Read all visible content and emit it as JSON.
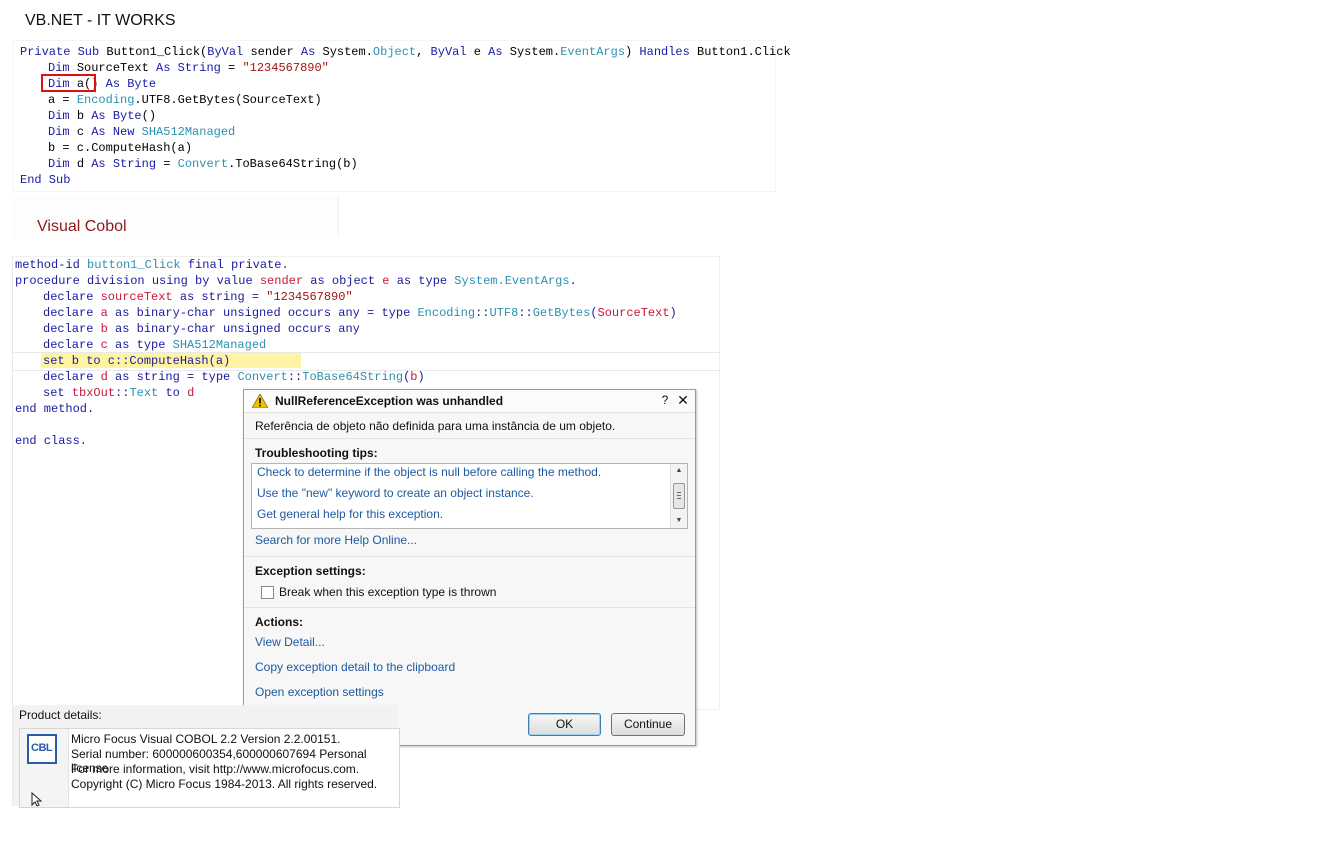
{
  "vb_heading": "VB.NET - IT WORKS",
  "vb_code": {
    "line1": {
      "kw1": "Private Sub ",
      "t1": "Button1_Click(",
      "kw2": "ByVal ",
      "t2": "sender ",
      "kw3": "As ",
      "t3": "System.",
      "ty1": "Object",
      "t4": ", ",
      "kw4": "ByVal ",
      "t5": "e ",
      "kw5": "As ",
      "t6": "System.",
      "ty2": "EventArgs",
      "t7": ") ",
      "kw6": "Handles ",
      "t8": "Button1.Click"
    },
    "line2": {
      "kw1": "Dim ",
      "t1": "SourceText ",
      "kw2": "As String ",
      "t2": "= ",
      "s1": "\"1234567890\""
    },
    "line3": {
      "kw1": "Dim ",
      "t1": "a() ",
      "kw2": "As Byte"
    },
    "line4": {
      "t1": "a = ",
      "ty1": "Encoding",
      "t2": ".UTF8.GetBytes(SourceText)"
    },
    "line5": {
      "kw1": "Dim ",
      "t1": "b ",
      "kw2": "As Byte",
      "t2": "()"
    },
    "line6": {
      "kw1": "Dim ",
      "t1": "c ",
      "kw2": "As New ",
      "ty1": "SHA512Managed"
    },
    "line7": {
      "t1": "b = c.ComputeHash(a)"
    },
    "line8": {
      "kw1": "Dim ",
      "t1": "d ",
      "kw2": "As String ",
      "t2": "= ",
      "ty1": "Convert",
      "t3": ".ToBase64String(b)"
    },
    "line9": {
      "kw1": "End Sub"
    }
  },
  "cobol_heading": "Visual Cobol",
  "cobol_code": {
    "line1": {
      "k1": "method-id ",
      "t1": "button1_Click ",
      "k2": "final private."
    },
    "line2": {
      "k1": "procedure division using by value ",
      "v1": "sender ",
      "k2": "as object ",
      "v2": "e ",
      "k3": "as type ",
      "t1": "System.EventArgs",
      "k4": "."
    },
    "line3": {
      "k1": "declare ",
      "v1": "sourceText ",
      "k2": "as string = ",
      "s1": "\"1234567890\""
    },
    "line4": {
      "k1": "declare ",
      "v1": "a ",
      "k2": "as binary-char unsigned occurs any = type ",
      "t1": "Encoding",
      "k3": "::",
      "t2": "UTF8",
      "k4": "::",
      "t3": "GetBytes",
      "k5": "(",
      "v2": "SourceText",
      "k6": ")"
    },
    "line5": {
      "k1": "declare ",
      "v1": "b ",
      "k2": "as binary-char unsigned occurs any"
    },
    "line6": {
      "k1": "declare ",
      "v1": "c ",
      "k2": "as type ",
      "t1": "SHA512Managed"
    },
    "line7": {
      "k1": "set b to c::ComputeHash(a)"
    },
    "line8": {
      "k1": "declare ",
      "v1": "d ",
      "k2": "as string = type ",
      "t1": "Convert",
      "k3": "::",
      "t2": "ToBase64String",
      "k4": "(",
      "v2": "b",
      "k5": ")"
    },
    "line9": {
      "k1": "set ",
      "v1": "tbxOut",
      "k2": "::",
      "t1": "Text",
      "k3": " to ",
      "v2": "d"
    },
    "line10": {
      "k1": "end method."
    },
    "line11": {
      "k1": "end class."
    }
  },
  "dialog": {
    "title": "NullReferenceException was unhandled",
    "help": "?",
    "close": "✕",
    "message": "Referência de objeto não definida para uma instância de um objeto.",
    "tips_label": "Troubleshooting tips:",
    "tips": [
      "Check to determine if the object is null before calling the method.",
      "Use the \"new\" keyword to create an object instance.",
      "Get general help for this exception."
    ],
    "search_online": "Search for more Help Online...",
    "exception_settings_label": "Exception settings:",
    "break_checkbox_label": "Break when this exception type is thrown",
    "actions_label": "Actions:",
    "actions": [
      "View Detail...",
      "Copy exception detail to the clipboard",
      "Open exception settings"
    ],
    "ok_label": "OK",
    "continue_label": "Continue"
  },
  "product": {
    "label": "Product details:",
    "logo_text": "CBL",
    "lines": [
      "Micro Focus Visual COBOL 2.2 Version 2.2.00151.",
      "Serial number: 600000600354,600000607694 Personal license",
      "For more information, visit http://www.microfocus.com.",
      "Copyright (C) Micro Focus 1984-2013. All rights reserved."
    ]
  },
  "colors": {
    "keyword": "#1a1aa6",
    "type": "#2b91af",
    "string": "#a31515",
    "cobol_var": "#c8173a",
    "link": "#1f5aa0",
    "highlight": "#fff4a3",
    "error_box": "#dd1111"
  },
  "icons": [
    "warning-icon",
    "help-icon",
    "close-icon",
    "scroll-up-icon",
    "scroll-down-icon",
    "cbl-logo-icon",
    "mouse-cursor-icon"
  ]
}
